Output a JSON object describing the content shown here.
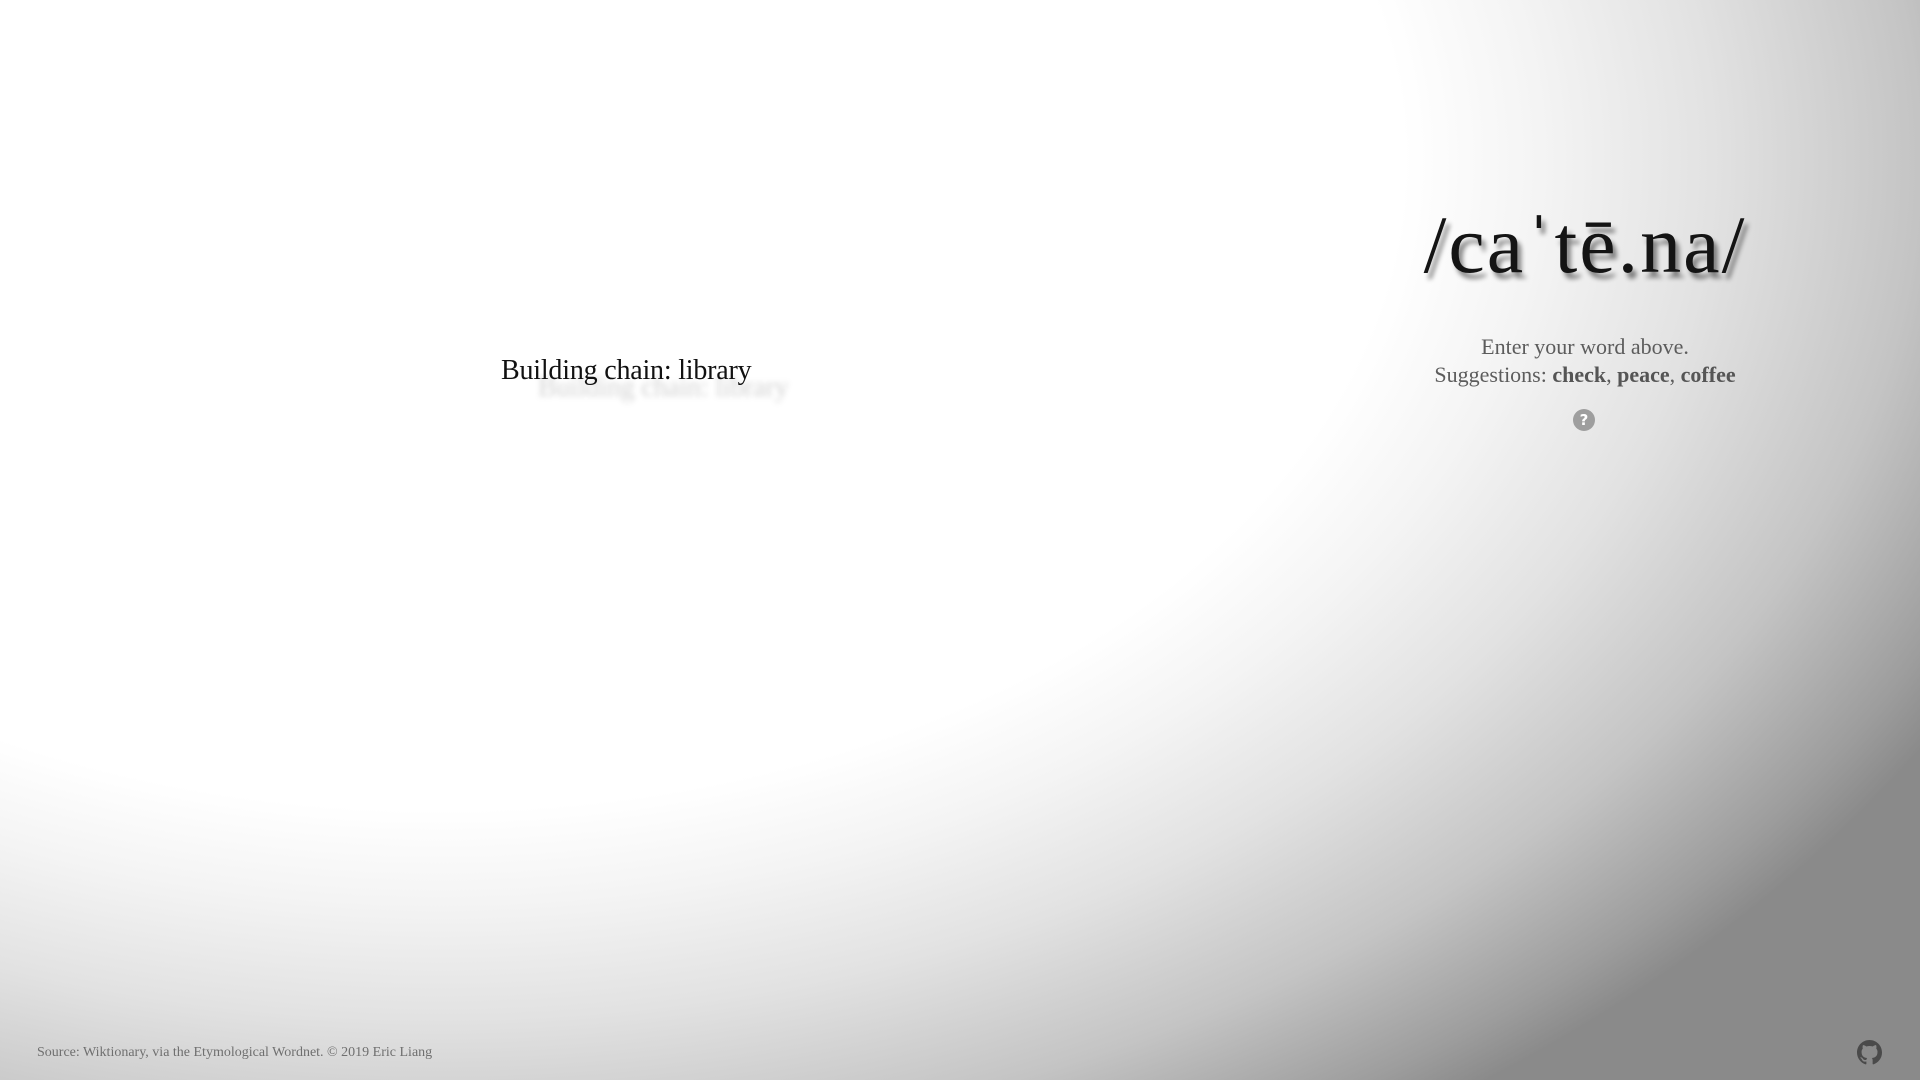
{
  "logo": {
    "text": "/caˈtē.na/"
  },
  "status": {
    "text": "Building chain: library"
  },
  "hint": {
    "line1": "Enter your word above.",
    "suggestions_label": "Suggestions:",
    "suggestions": [
      "check",
      "peace",
      "coffee"
    ],
    "separator": ", "
  },
  "help": {
    "icon": "question-circle-icon",
    "glyph": "?"
  },
  "footer": {
    "text": "Source: Wiktionary, via the Etymological Wordnet. © 2019 Eric Liang"
  },
  "github": {
    "icon": "github-icon"
  },
  "colors": {
    "text_dark": "#141414",
    "hint_text": "#5c5c5c",
    "footer_text": "#6f6f6f",
    "icon_gray": "#9e9e9e",
    "bg_light": "#ffffff",
    "bg_dark": "#8a8a8a"
  }
}
